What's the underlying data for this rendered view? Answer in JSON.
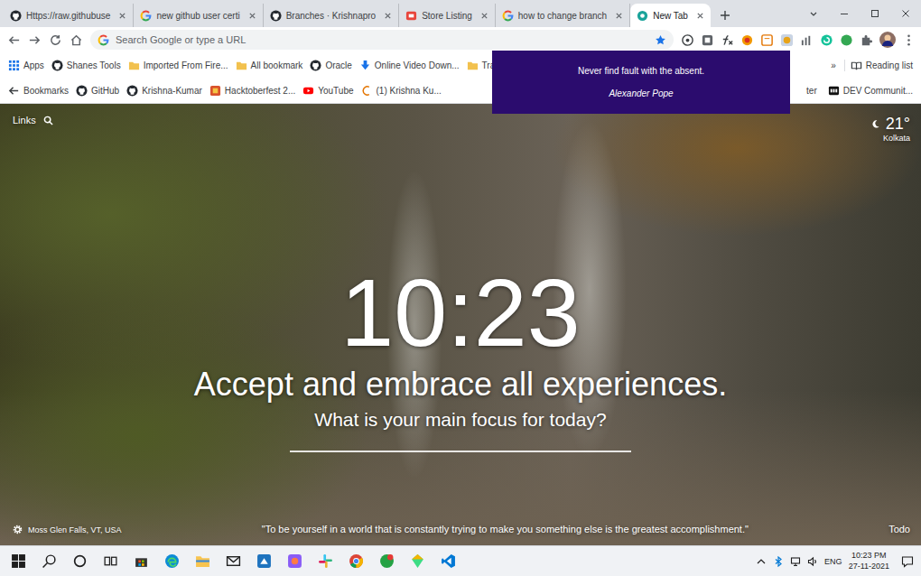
{
  "tabs": [
    {
      "label": "Https://raw.githubuse",
      "kind": "github",
      "selected": false
    },
    {
      "label": "new github user certi",
      "kind": "google",
      "selected": false
    },
    {
      "label": "Branches · Krishnapro",
      "kind": "github",
      "selected": false
    },
    {
      "label": "Store Listing",
      "kind": "store",
      "selected": false
    },
    {
      "label": "how to change branch",
      "kind": "google",
      "selected": false
    },
    {
      "label": "New Tab",
      "kind": "newtab",
      "selected": true
    }
  ],
  "omnibox": {
    "placeholder": "Search Google or type a URL"
  },
  "bookmarks_bar": {
    "items": [
      {
        "label": "Apps",
        "kind": "apps"
      },
      {
        "label": "Shanes Tools",
        "kind": "github"
      },
      {
        "label": "Imported From Fire...",
        "kind": "folder"
      },
      {
        "label": "All bookmark",
        "kind": "folder"
      },
      {
        "label": "Oracle",
        "kind": "github"
      },
      {
        "label": "Online Video Down...",
        "kind": "download"
      },
      {
        "label": "Tra",
        "kind": "folder"
      }
    ],
    "overflow": "»",
    "reading_list": "Reading list"
  },
  "bookmarks_bar_2": {
    "items": [
      {
        "label": "Bookmarks",
        "kind": "back"
      },
      {
        "label": "GitHub",
        "kind": "github"
      },
      {
        "label": "Krishna-Kumar",
        "kind": "github"
      },
      {
        "label": "Hacktoberfest 2...",
        "kind": "hack"
      },
      {
        "label": "YouTube",
        "kind": "youtube"
      },
      {
        "label": "(1) Krishna Ku...",
        "kind": "site"
      }
    ],
    "right_items": [
      {
        "label": "ter",
        "kind": "none"
      },
      {
        "label": "DEV Communit...",
        "kind": "dev"
      }
    ]
  },
  "quote_popup": {
    "text": "Never find fault with the absent.",
    "author": "Alexander Pope"
  },
  "new_tab_page": {
    "links": "Links",
    "temperature": "21°",
    "city": "Kolkata",
    "clock": "10:23",
    "mantra": "Accept and embrace all experiences.",
    "focus_prompt": "What is your main focus for today?",
    "photo_location": "Moss Glen Falls, VT, USA",
    "quote": "\"To be yourself in a world that is constantly trying to make you something else is the greatest accomplishment.\"",
    "todo": "Todo"
  },
  "taskbar": {
    "language": "ENG",
    "time": "10:23 PM",
    "date": "27-11-2021"
  }
}
